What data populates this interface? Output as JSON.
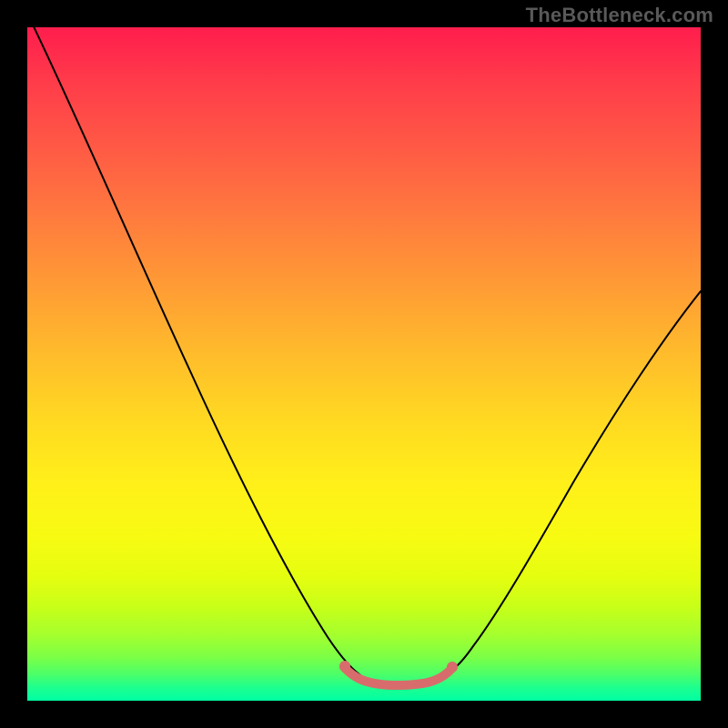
{
  "watermark": {
    "text": "TheBottleneck.com"
  },
  "chart_data": {
    "type": "line",
    "title": "",
    "xlabel": "",
    "ylabel": "",
    "xlim": [
      0,
      100
    ],
    "ylim": [
      0,
      100
    ],
    "grid": false,
    "legend": false,
    "background": "vertical red-to-green gradient (bottleneck heatmap)",
    "series": [
      {
        "name": "bottleneck-curve",
        "x": [
          0,
          5,
          10,
          15,
          20,
          25,
          30,
          35,
          40,
          45,
          48,
          50,
          52,
          55,
          58,
          60,
          64,
          70,
          76,
          82,
          88,
          94,
          100
        ],
        "y": [
          100,
          91,
          82,
          73,
          64,
          55,
          46,
          37,
          27,
          16,
          8,
          3,
          1,
          0,
          0,
          1,
          3,
          9,
          18,
          28,
          38,
          48,
          58
        ]
      }
    ],
    "annotations": [
      {
        "name": "optimal-range",
        "x": [
          48,
          62
        ],
        "y": 3,
        "style": "thick salmon segment at curve minimum"
      }
    ],
    "colors": {
      "curve": "#000000",
      "optimal_range": "#d86c6c",
      "gradient_top": "#ff1d4d",
      "gradient_bottom": "#00ffa3",
      "frame": "#000000"
    }
  }
}
